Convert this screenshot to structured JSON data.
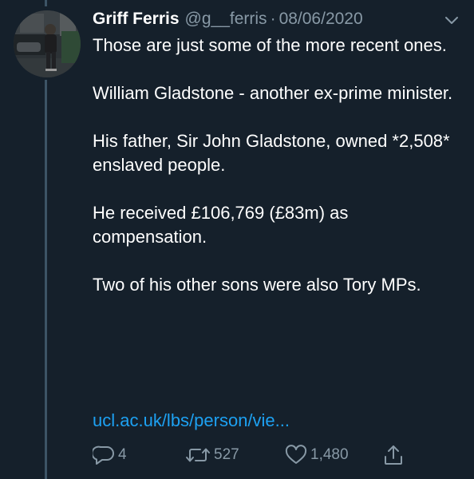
{
  "tweet": {
    "display_name": "Griff Ferris",
    "handle": "@g__ferris",
    "separator": "·",
    "date": "08/06/2020",
    "paragraphs": [
      "Those are just some of the more recent ones.",
      "William Gladstone - another ex-prime minister.",
      "His father, Sir John Gladstone, owned *2,508* enslaved people.",
      "He received £106,769 (£83m) as compensation.",
      "Two of his other sons were also Tory MPs."
    ],
    "link": "ucl.ac.uk/lbs/person/vie..."
  },
  "actions": {
    "reply_count": "4",
    "retweet_count": "527",
    "like_count": "1,480"
  },
  "icons": {
    "avatar": "user-avatar",
    "menu": "chevron-down-icon",
    "reply": "reply-icon",
    "retweet": "retweet-icon",
    "like": "heart-icon",
    "share": "share-icon"
  },
  "colors": {
    "background": "#15202b",
    "text_primary": "#ffffff",
    "text_secondary": "#8899a6",
    "link": "#1da1f2",
    "thread_line": "#3d5466"
  }
}
